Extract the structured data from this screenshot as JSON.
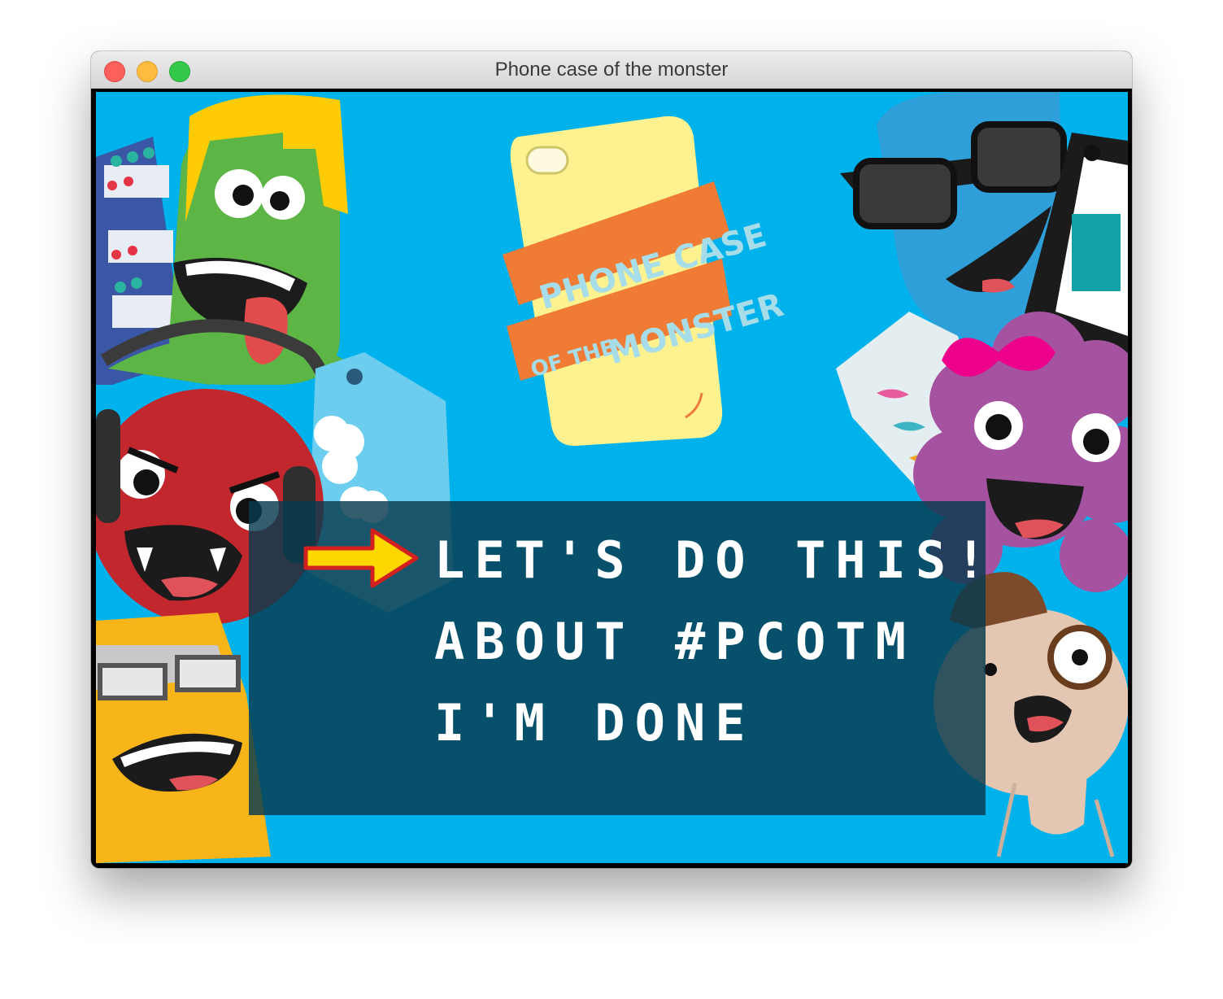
{
  "window": {
    "title": "Phone case of the monster"
  },
  "logo": {
    "line1": "PHONE CASE",
    "line2a": "OF THE",
    "line2b": "MONSTER"
  },
  "menu": {
    "selected_index": 0,
    "items": [
      {
        "label": "LET'S DO THIS!"
      },
      {
        "label": "ABOUT #PCOTM"
      },
      {
        "label": "I'M DONE"
      }
    ]
  },
  "colors": {
    "background": "#00b2ec",
    "panel": "#0a3a4e",
    "menu_text": "#ffffff",
    "arrow": "#ffd700",
    "logo_ribbon": "#ef7b34",
    "logo_text": "#a6dde8"
  }
}
